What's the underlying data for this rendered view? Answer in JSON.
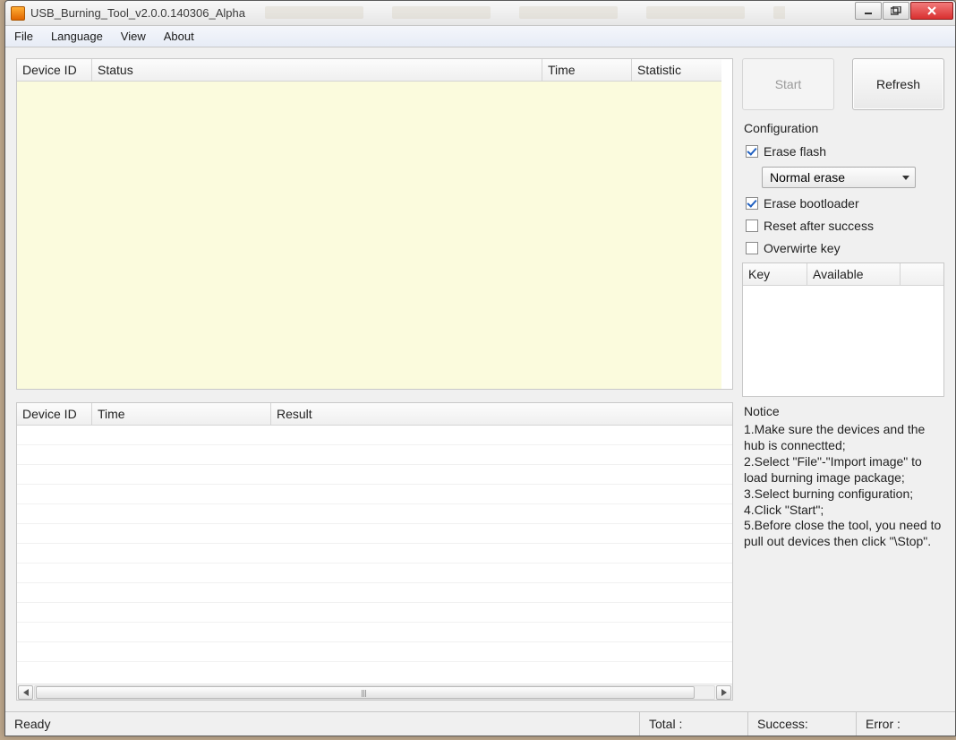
{
  "window": {
    "title": "USB_Burning_Tool_v2.0.0.140306_Alpha"
  },
  "menu": {
    "file": "File",
    "language": "Language",
    "view": "View",
    "about": "About"
  },
  "table_devices": {
    "cols": {
      "device_id": "Device ID",
      "status": "Status",
      "time": "Time",
      "statistic": "Statistic"
    }
  },
  "table_results": {
    "cols": {
      "device_id": "Device ID",
      "time": "Time",
      "result": "Result"
    }
  },
  "buttons": {
    "start": "Start",
    "refresh": "Refresh"
  },
  "config": {
    "label": "Configuration",
    "erase_flash": {
      "label": "Erase flash",
      "checked": true
    },
    "erase_mode_selected": "Normal erase",
    "erase_bootloader": {
      "label": "Erase bootloader",
      "checked": true
    },
    "reset_after_success": {
      "label": "Reset after success",
      "checked": false
    },
    "overwrite_key": {
      "label": "Overwirte key",
      "checked": false
    }
  },
  "key_table": {
    "cols": {
      "key": "Key",
      "available": "Available"
    }
  },
  "notice": {
    "title": "Notice",
    "body": "1.Make sure the devices and the hub is connectted;\n2.Select \"File\"-\"Import image\" to load burning image package;\n3.Select burning configuration;\n4.Click \"Start\";\n5.Before close the tool, you need to pull out devices then click \"\\Stop\"."
  },
  "status": {
    "ready": "Ready",
    "total": "Total :",
    "success": "Success:",
    "error": "Error :"
  }
}
